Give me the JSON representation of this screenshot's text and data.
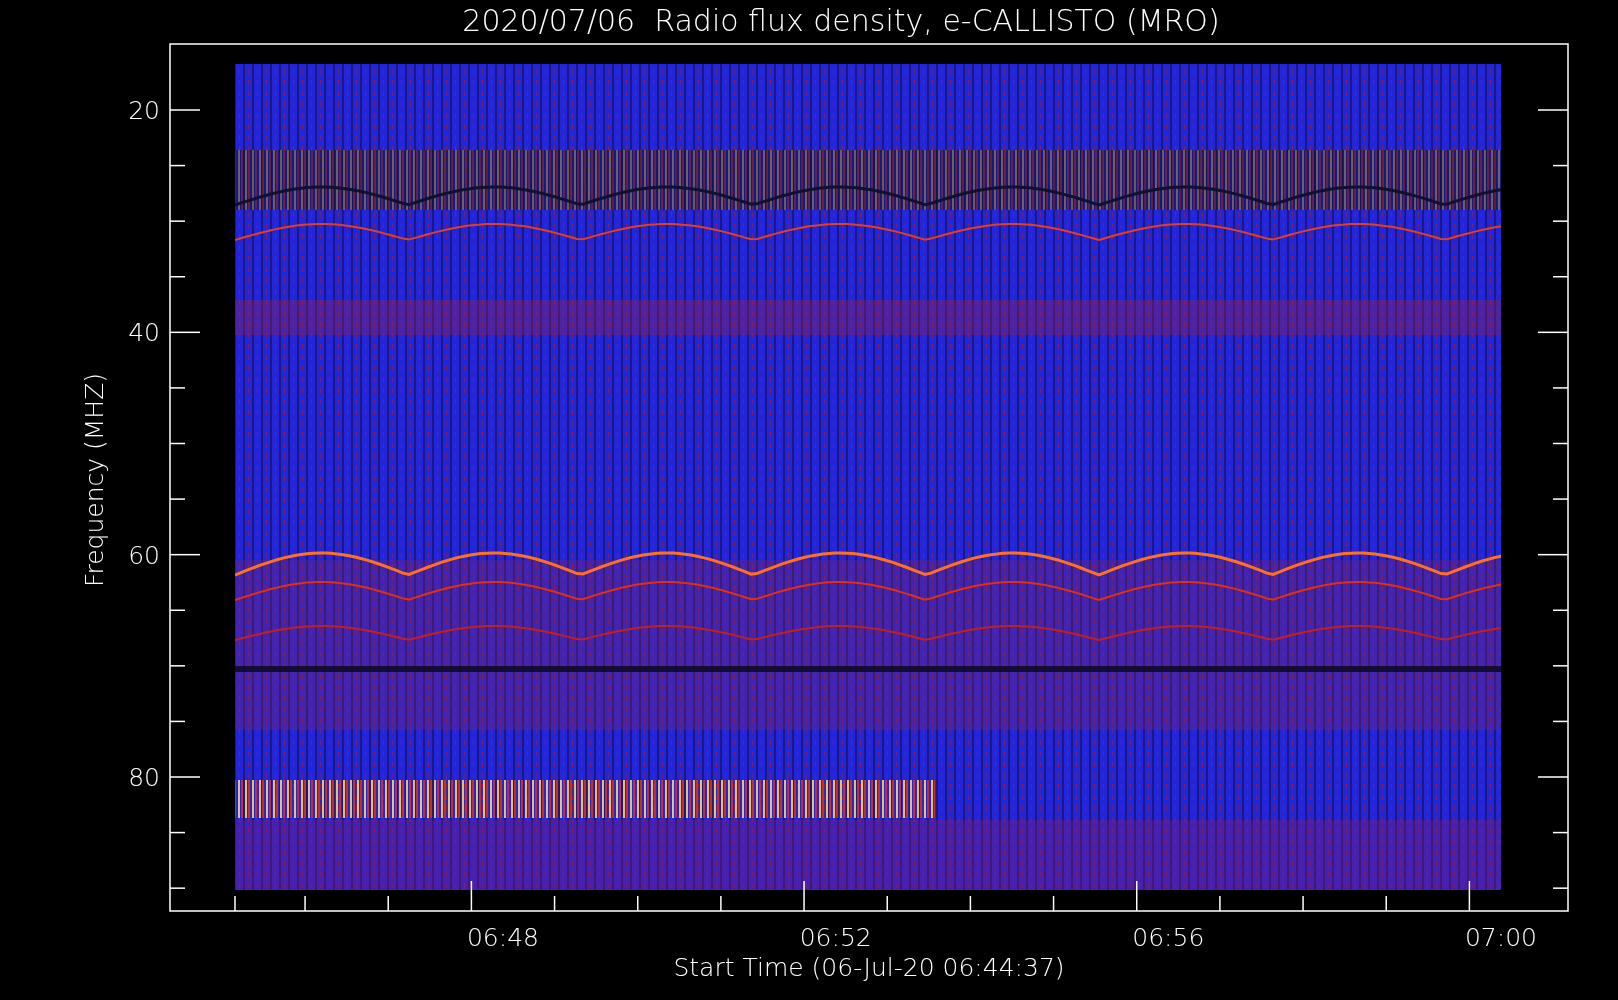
{
  "title": "2020/07/06  Radio flux density, e-CALLISTO (MRO)",
  "y_axis": {
    "label": "Frequency (MHZ)",
    "ticks": [
      "20",
      "40",
      "60",
      "80"
    ]
  },
  "x_axis": {
    "label": "Start Time (06-Jul-20 06:44:37)",
    "ticks": [
      "06:48",
      "06:52",
      "06:56",
      "07:00"
    ]
  }
}
